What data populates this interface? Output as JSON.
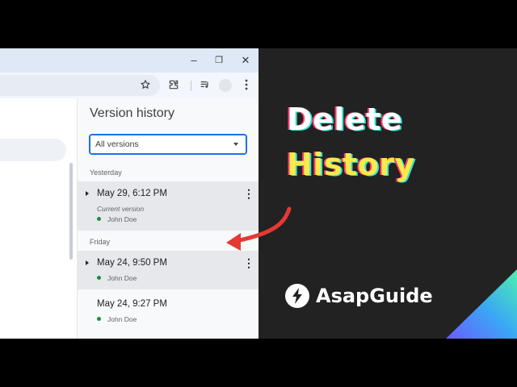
{
  "browser": {
    "window_controls": {
      "minimize": "–",
      "restore": "❐",
      "close": "✕"
    },
    "toolbar_icons": [
      "star-icon",
      "extension-icon",
      "media-queue-icon",
      "profile-avatar",
      "kebab-menu-icon"
    ]
  },
  "version_panel": {
    "title": "Version history",
    "filter": {
      "selected": "All versions"
    },
    "groups": [
      {
        "label": "Yesterday",
        "versions": [
          {
            "date": "May 29, 6:12 PM",
            "note": "Current version",
            "author": "John Doe",
            "selected": true,
            "expandable": true
          }
        ]
      },
      {
        "label": "Friday",
        "versions": [
          {
            "date": "May 24, 9:50 PM",
            "author": "John Doe",
            "selected": true,
            "expandable": true
          },
          {
            "date": "May 24, 9:27 PM",
            "author": "John Doe",
            "selected": false,
            "expandable": false
          }
        ]
      }
    ]
  },
  "promo": {
    "headline_line1": "Delete",
    "headline_line2": "History",
    "brand_name": "AsapGuide",
    "colors": {
      "headline_primary": "#ffffff",
      "headline_accent": "#ffe94a",
      "arrow": "#e53935",
      "background": "#222222"
    }
  }
}
